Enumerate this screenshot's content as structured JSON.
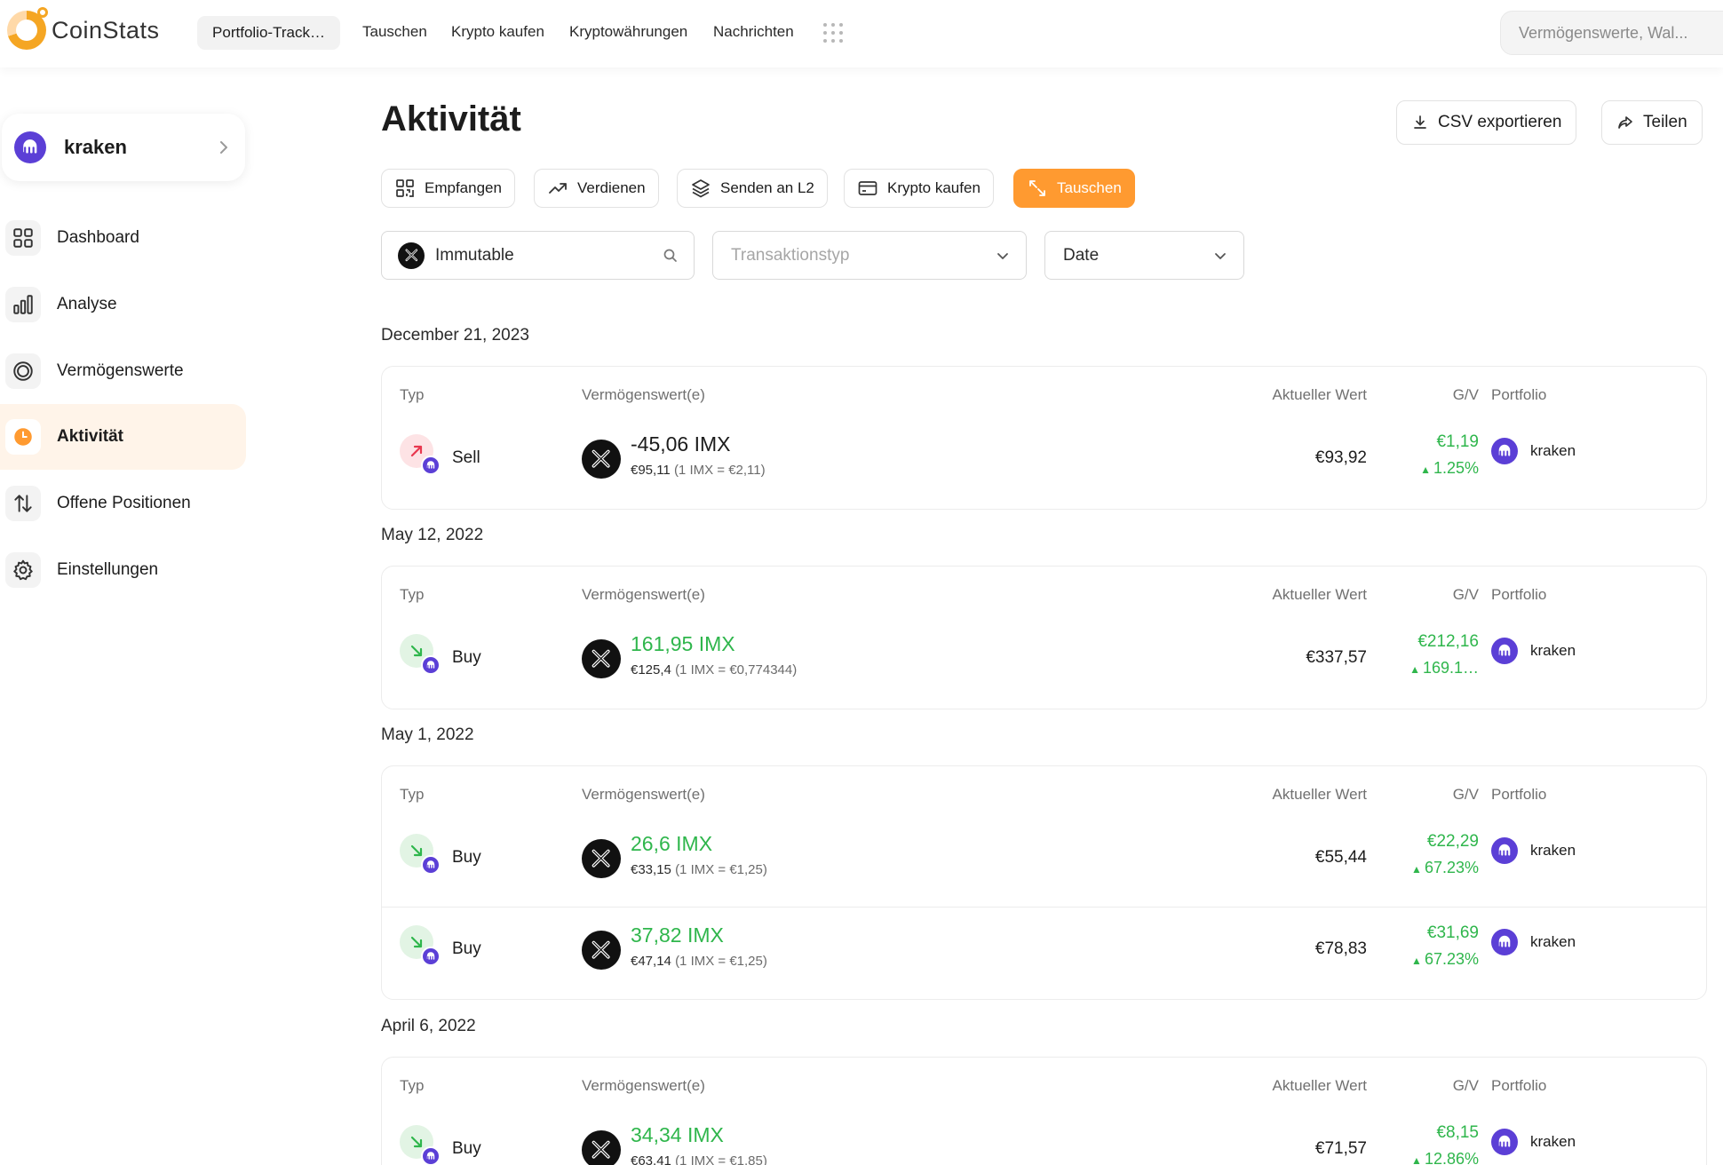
{
  "brand": {
    "name": "CoinStats"
  },
  "topnav": {
    "active_pill": "Portfolio-Track…",
    "links": [
      "Tauschen",
      "Krypto kaufen",
      "Kryptowährungen",
      "Nachrichten"
    ],
    "search_placeholder": "Vermögenswerte, Wal..."
  },
  "sidebar": {
    "portfolio": "kraken",
    "items": [
      {
        "label": "Dashboard",
        "icon": "dashboard-icon"
      },
      {
        "label": "Analyse",
        "icon": "bar-chart-icon"
      },
      {
        "label": "Vermögenswerte",
        "icon": "coin-icon"
      },
      {
        "label": "Aktivität",
        "icon": "clock-icon",
        "active": true
      },
      {
        "label": "Offene Positionen",
        "icon": "swap-vertical-icon"
      },
      {
        "label": "Einstellungen",
        "icon": "gear-icon"
      }
    ]
  },
  "main": {
    "title": "Aktivität",
    "export_label": "CSV exportieren",
    "share_label": "Teilen",
    "actions": [
      "Empfangen",
      "Verdienen",
      "Senden an L2",
      "Krypto kaufen",
      "Tauschen"
    ],
    "filters": {
      "asset": "Immutable",
      "type_placeholder": "Transaktionstyp",
      "date": "Date"
    },
    "columns": {
      "type": "Typ",
      "asset": "Vermögenswert(e)",
      "value": "Aktueller Wert",
      "pnl": "G/V",
      "portfolio": "Portfolio"
    }
  },
  "groups": [
    {
      "date": "December 21, 2023",
      "rows": [
        {
          "type": "Sell",
          "amount": "-45,06 IMX",
          "cost": "€95,11",
          "rate": "(1 IMX = €2,11)",
          "value": "€93,92",
          "pnl": "€1,19",
          "pct": "1.25%",
          "portfolio": "kraken"
        }
      ]
    },
    {
      "date": "May 12, 2022",
      "rows": [
        {
          "type": "Buy",
          "amount": "161,95 IMX",
          "cost": "€125,4",
          "rate": "(1 IMX = €0,774344)",
          "value": "€337,57",
          "pnl": "€212,16",
          "pct": "169.1…",
          "portfolio": "kraken"
        }
      ]
    },
    {
      "date": "May 1, 2022",
      "rows": [
        {
          "type": "Buy",
          "amount": "26,6 IMX",
          "cost": "€33,15",
          "rate": "(1 IMX = €1,25)",
          "value": "€55,44",
          "pnl": "€22,29",
          "pct": "67.23%",
          "portfolio": "kraken"
        },
        {
          "type": "Buy",
          "amount": "37,82 IMX",
          "cost": "€47,14",
          "rate": "(1 IMX = €1,25)",
          "value": "€78,83",
          "pnl": "€31,69",
          "pct": "67.23%",
          "portfolio": "kraken"
        }
      ]
    },
    {
      "date": "April 6, 2022",
      "rows": [
        {
          "type": "Buy",
          "amount": "34,34 IMX",
          "cost": "€63,41",
          "rate": "(1 IMX = €1,85)",
          "value": "€71,57",
          "pnl": "€8,15",
          "pct": "12.86%",
          "portfolio": "kraken"
        }
      ]
    }
  ],
  "colors": {
    "accent": "#ff9a30",
    "positive": "#2fb64c",
    "kraken": "#5b3fd6"
  }
}
